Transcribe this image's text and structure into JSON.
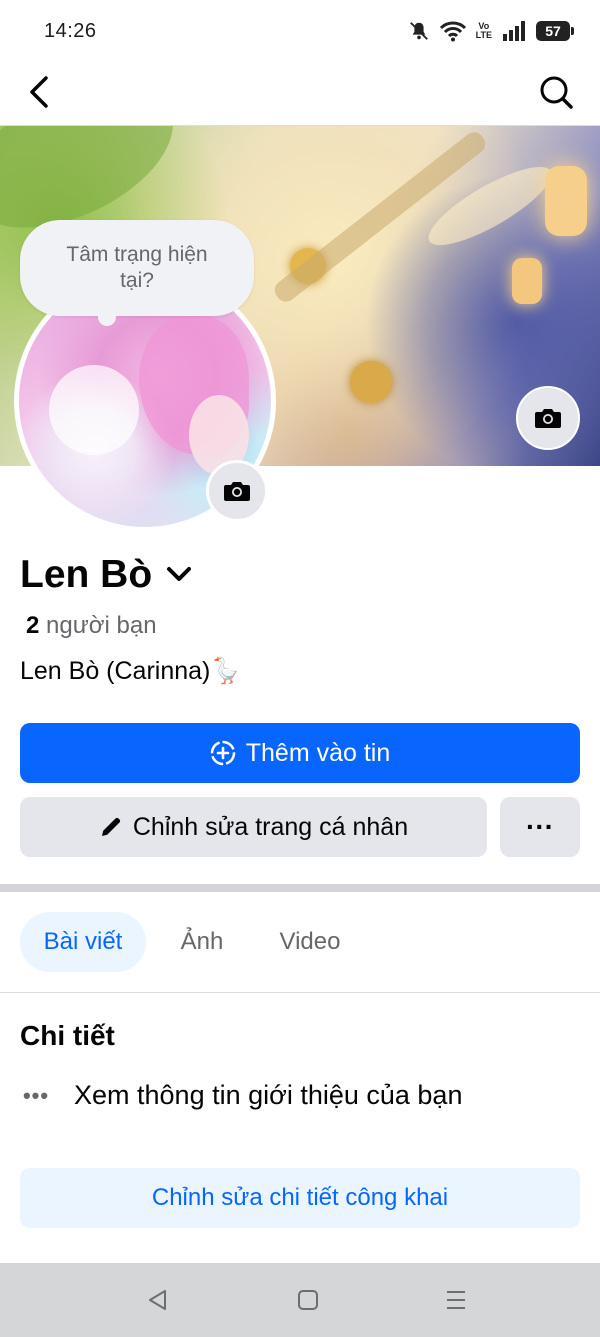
{
  "status_bar": {
    "time": "14:26",
    "battery": "57",
    "volte_top": "Vo",
    "volte_bottom": "LTE"
  },
  "mood_prompt": "Tâm trạng hiện tại?",
  "profile": {
    "name": "Len Bò",
    "friend_count": "2",
    "friend_label": "người bạn",
    "bio": "Len Bò (Carinna)🪿"
  },
  "actions": {
    "add_story": "Thêm vào tin",
    "edit_profile": "Chỉnh sửa trang cá nhân",
    "more": "···"
  },
  "tabs": [
    {
      "label": "Bài viết",
      "active": true
    },
    {
      "label": "Ảnh",
      "active": false
    },
    {
      "label": "Video",
      "active": false
    }
  ],
  "details": {
    "title": "Chi tiết",
    "about_link": "Xem thông tin giới thiệu của bạn",
    "edit_public_details": "Chỉnh sửa chi tiết công khai"
  },
  "colors": {
    "accent": "#0866ff",
    "tab_active_bg": "#ebf5ff",
    "secondary_bg": "#e4e6eb"
  }
}
